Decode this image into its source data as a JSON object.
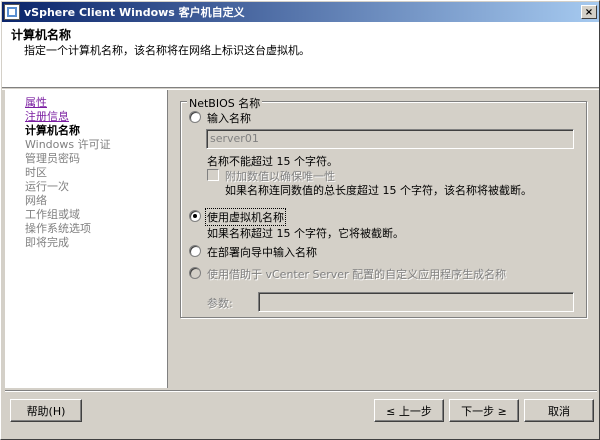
{
  "window": {
    "title": "vSphere Client Windows 客户机自定义",
    "close_symbol": "×"
  },
  "header": {
    "title": "计算机名称",
    "description": "指定一个计算机名称，该名称将在网络上标识这台虚拟机。"
  },
  "nav": {
    "items": [
      {
        "label": "属性",
        "state": "link"
      },
      {
        "label": "注册信息",
        "state": "link"
      },
      {
        "label": "计算机名称",
        "state": "current"
      },
      {
        "label": "Windows 许可证",
        "state": "disabled"
      },
      {
        "label": "管理员密码",
        "state": "disabled"
      },
      {
        "label": "时区",
        "state": "disabled"
      },
      {
        "label": "运行一次",
        "state": "disabled"
      },
      {
        "label": "网络",
        "state": "disabled"
      },
      {
        "label": "工作组或域",
        "state": "disabled"
      },
      {
        "label": "操作系统选项",
        "state": "disabled"
      },
      {
        "label": "即将完成",
        "state": "disabled"
      }
    ]
  },
  "netbios": {
    "legend": "NetBIOS 名称",
    "enter_name_label": "输入名称",
    "name_value": "server01",
    "name_hint": "名称不能超过 15 个字符。",
    "append_numeric_label": "附加数值以确保唯一性",
    "append_hint": "如果名称连同数值的总长度超过 15 个字符，该名称将被截断。",
    "use_vm_name_label": "使用虚拟机名称",
    "vm_name_hint": "如果名称超过 15 个字符，它将被截断。",
    "wizard_enter_label": "在部署向导中输入名称",
    "vcenter_app_label": "使用借助于 vCenter Server 配置的自定义应用程序生成名称",
    "params_label": "参数:",
    "params_value": "",
    "selected": "use_vm_name"
  },
  "footer": {
    "help": "帮助(H)",
    "back": "≤ 上一步",
    "next": "下一步 ≥",
    "cancel": "取消"
  }
}
